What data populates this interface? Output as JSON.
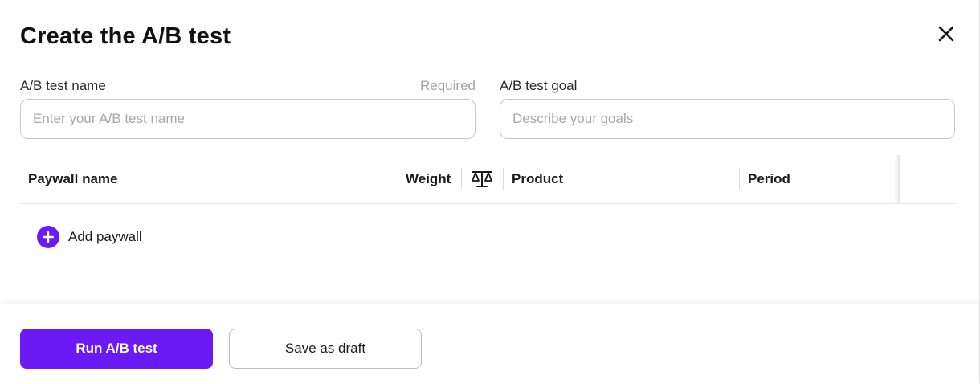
{
  "modal": {
    "title": "Create the A/B test",
    "close_icon": "close-icon"
  },
  "form": {
    "name": {
      "label": "A/B test name",
      "required": "Required",
      "value": "",
      "placeholder": "Enter your A/B test name"
    },
    "goal": {
      "label": "A/B test goal",
      "value": "",
      "placeholder": "Describe your goals"
    }
  },
  "table": {
    "columns": {
      "paywall_name": "Paywall name",
      "weight": "Weight",
      "product": "Product",
      "period": "Period"
    },
    "balance_icon": "balance-scale-icon",
    "add_paywall": {
      "label": "Add paywall",
      "icon": "plus-circle-icon"
    }
  },
  "footer": {
    "primary": "Run A/B test",
    "secondary": "Save as draft"
  },
  "colors": {
    "accent": "#6A1BF5",
    "border": "#C9C9C9",
    "placeholder": "#A7A7A7"
  }
}
